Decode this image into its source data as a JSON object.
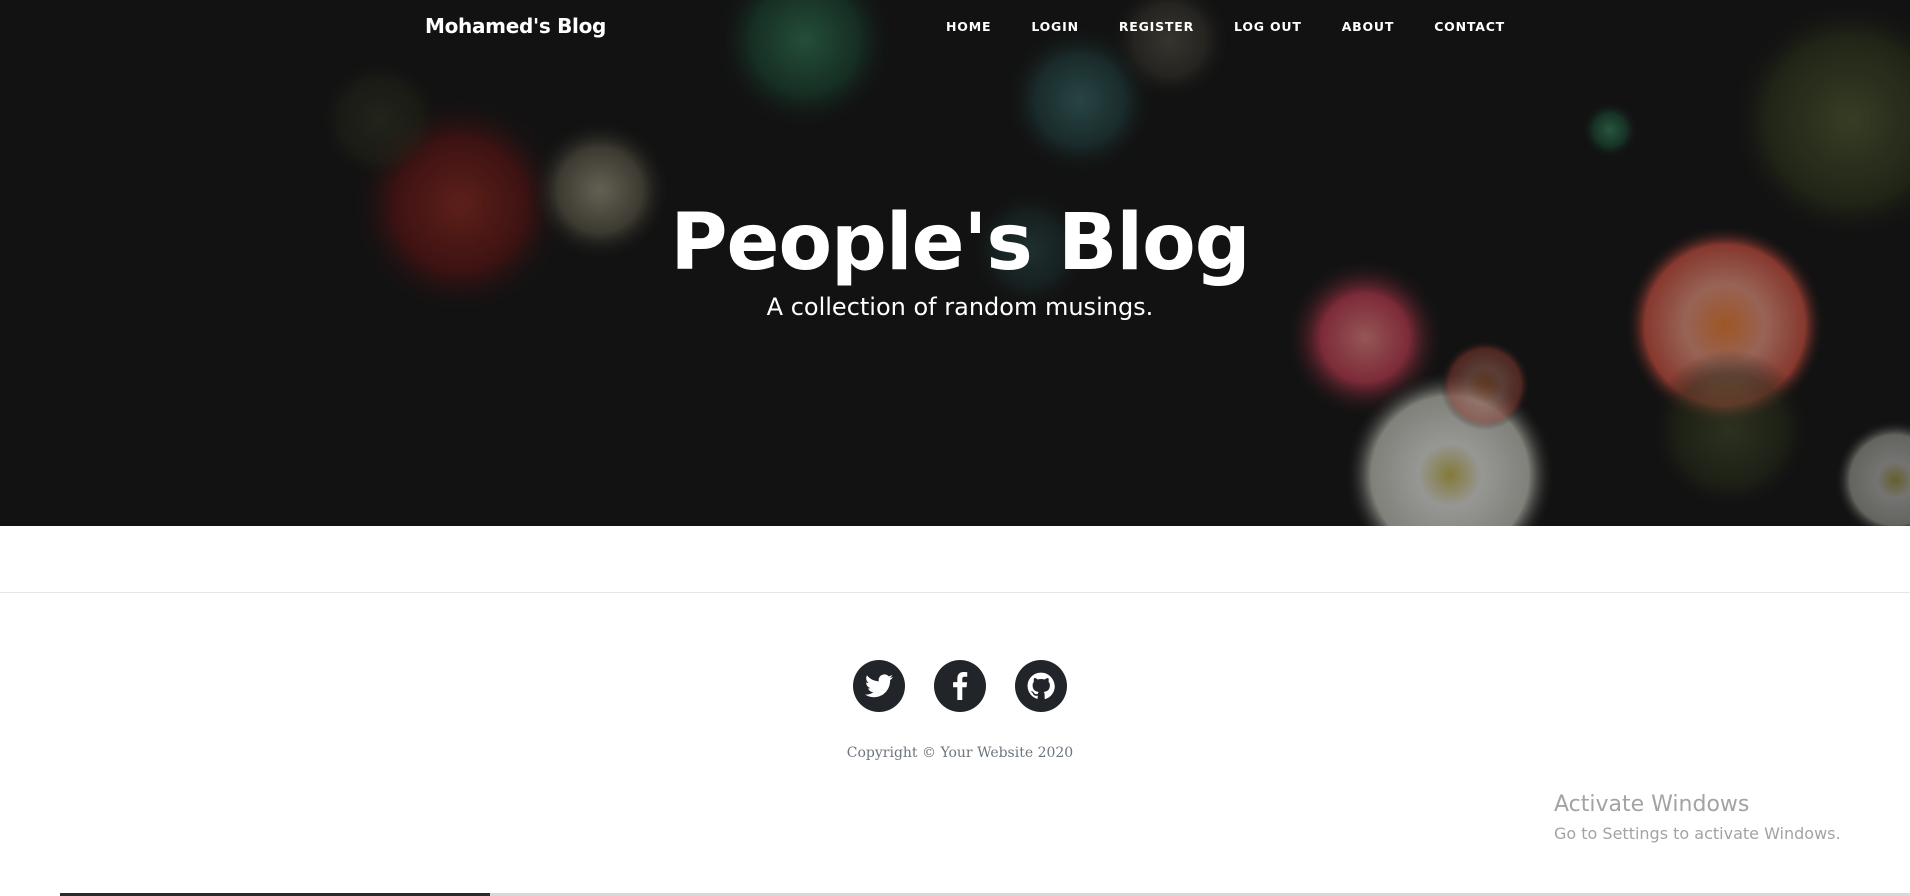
{
  "navbar": {
    "brand": "Mohamed's Blog",
    "links": [
      "HOME",
      "LOGIN",
      "REGISTER",
      "LOG OUT",
      "ABOUT",
      "CONTACT"
    ]
  },
  "hero": {
    "title": "People's Blog",
    "subtitle": "A collection of random musings."
  },
  "footer": {
    "social": [
      {
        "icon": "twitter-icon"
      },
      {
        "icon": "facebook-icon"
      },
      {
        "icon": "github-icon"
      }
    ],
    "copyright": "Copyright © Your Website 2020"
  },
  "overlay": {
    "activate_title": "Activate Windows",
    "activate_subtitle": "Go to Settings to activate Windows."
  },
  "colors": {
    "social_bg": "#212529",
    "copyright_text": "#6c757d",
    "hero_overlay": "#000000"
  }
}
